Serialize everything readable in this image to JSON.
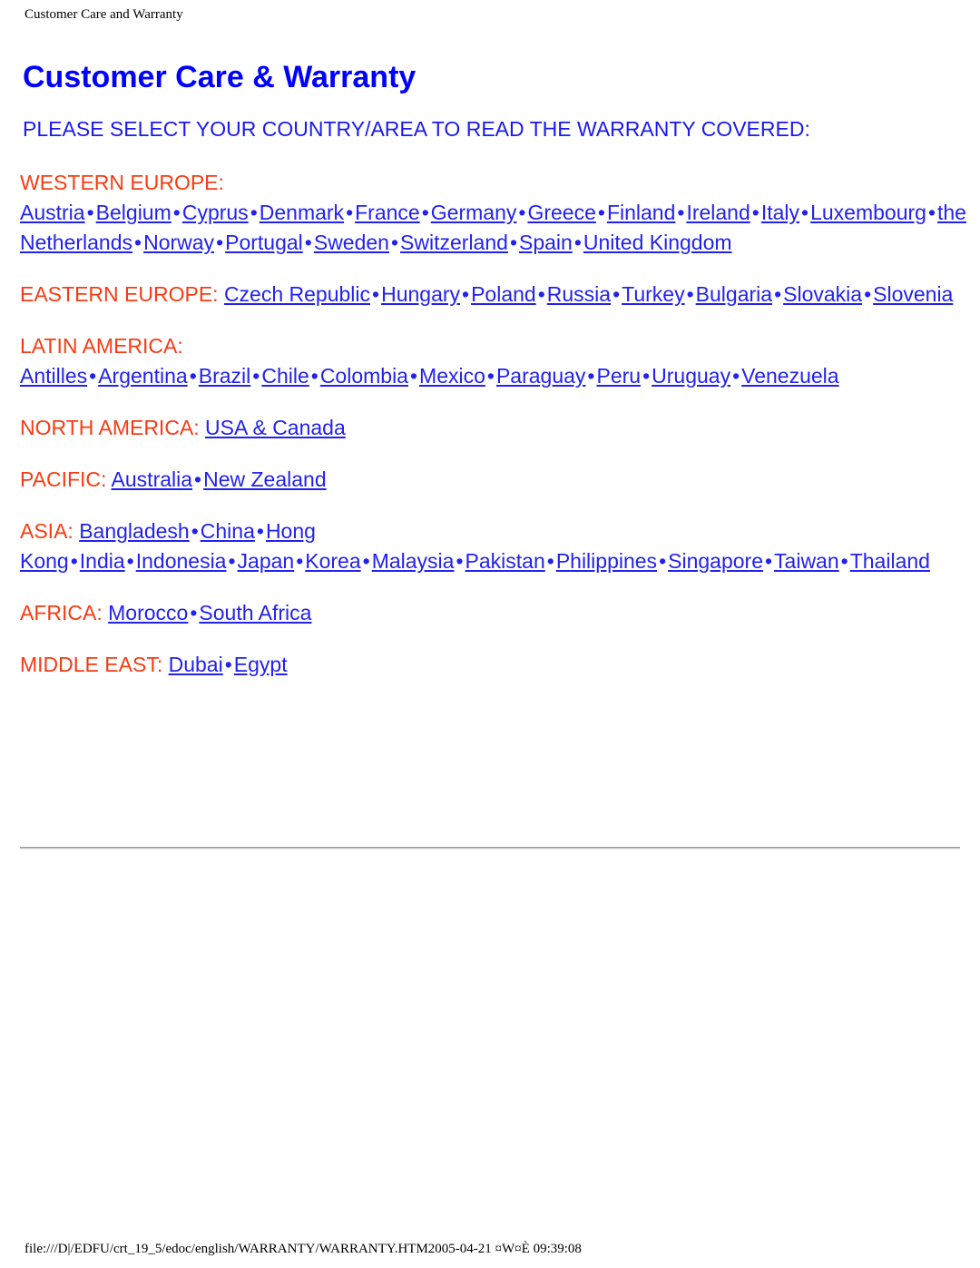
{
  "page": {
    "running_header": "Customer Care and Warranty",
    "footer": "file:///D|/EDFU/crt_19_5/edoc/english/WARRANTY/WARRANTY.HTM2005-04-21 ¤W¤È 09:39:08"
  },
  "document": {
    "title": "Customer Care & Warranty",
    "subtitle": "PLEASE SELECT YOUR COUNTRY/AREA TO READ THE WARRANTY COVERED:",
    "separator": "•"
  },
  "colors": {
    "title_blue": "#0000FF",
    "link_blue": "#2222EE",
    "region_orange": "#F83B12",
    "page_background": "#FFFFFF",
    "divider": "#C9C9C9"
  },
  "regions": [
    {
      "label": "WESTERN EUROPE:",
      "countries": [
        "Austria",
        "Belgium",
        "Cyprus",
        "Denmark",
        "France",
        "Germany",
        "Greece",
        "Finland",
        "Ireland",
        "Italy",
        "Luxembourg",
        "the Netherlands",
        "Norway",
        "Portugal",
        "Sweden",
        "Switzerland",
        "Spain",
        "United Kingdom"
      ]
    },
    {
      "label": "EASTERN EUROPE:",
      "countries": [
        "Czech Republic",
        "Hungary",
        "Poland",
        "Russia",
        "Turkey",
        "Bulgaria",
        "Slovakia",
        "Slovenia"
      ]
    },
    {
      "label": "LATIN AMERICA:",
      "countries": [
        "Antilles",
        "Argentina",
        "Brazil",
        "Chile",
        "Colombia",
        "Mexico",
        "Paraguay",
        "Peru",
        "Uruguay",
        "Venezuela"
      ]
    },
    {
      "label": "NORTH AMERICA:",
      "countries": [
        "USA & Canada "
      ]
    },
    {
      "label": "PACIFIC:",
      "countries": [
        "Australia",
        "New Zealand"
      ]
    },
    {
      "label": "ASIA:",
      "countries": [
        "Bangladesh",
        "China",
        "Hong Kong",
        "India",
        "Indonesia",
        "Japan",
        "Korea",
        "Malaysia",
        "Pakistan",
        "Philippines",
        "Singapore",
        "Taiwan",
        "Thailand"
      ]
    },
    {
      "label": "AFRICA:",
      "countries": [
        "Morocco",
        "South Africa"
      ]
    },
    {
      "label": "MIDDLE EAST:",
      "countries": [
        "Dubai",
        "Egypt"
      ]
    }
  ]
}
